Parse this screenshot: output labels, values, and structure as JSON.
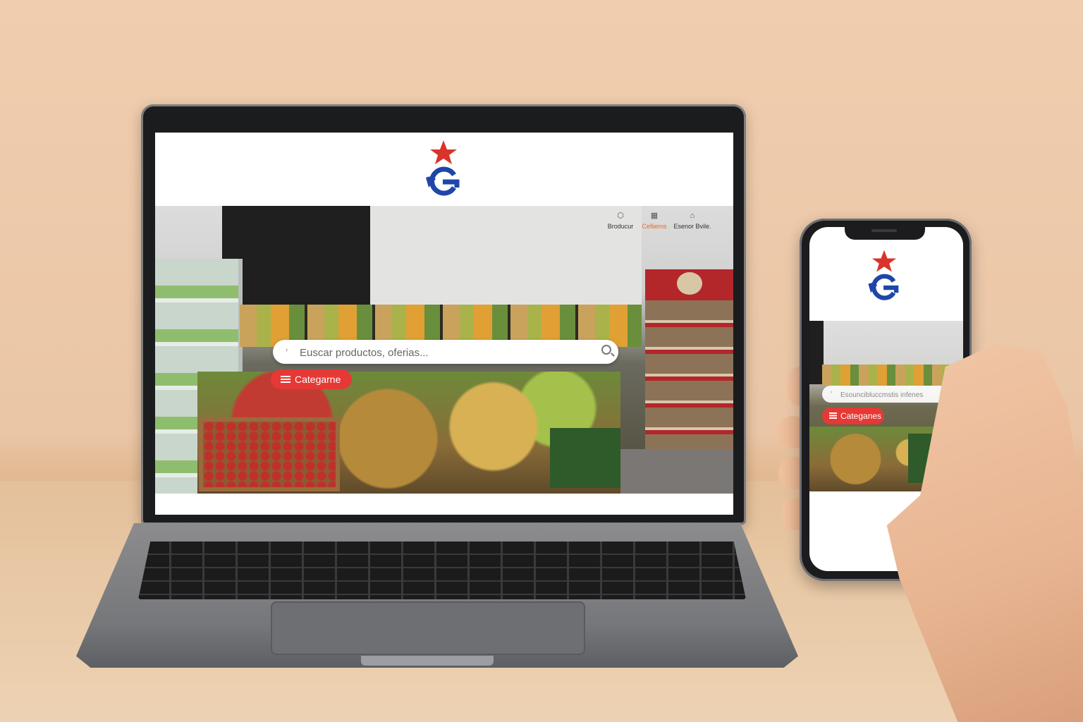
{
  "colors": {
    "brand_red": "#e53935",
    "brand_blue": "#1f46a8",
    "star_red": "#d9342b",
    "active_link": "#e36a2a"
  },
  "laptop": {
    "header": {
      "logo": "star-g-logo"
    },
    "nav_links": [
      {
        "icon": "box-icon",
        "label": "Broducur"
      },
      {
        "icon": "grid-icon",
        "label": "Cefiiems",
        "active": true
      },
      {
        "icon": "store-icon",
        "label": "Esenor Bvile."
      }
    ],
    "search": {
      "placeholder": "Euscar productos, oferias..."
    },
    "categories_button": {
      "label": "Categarne"
    }
  },
  "phone": {
    "header": {
      "logo": "star-g-logo"
    },
    "search": {
      "placeholder": "Esouncibluccmstis infenes"
    },
    "categories_button": {
      "label": "Categanes"
    }
  }
}
